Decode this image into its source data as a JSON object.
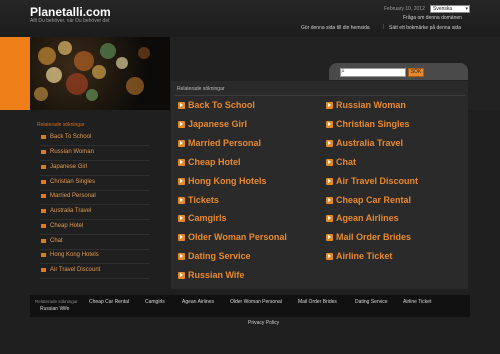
{
  "header": {
    "site_name": "Planetalli.com",
    "tagline": "Allt Du behöver, när Du behöver det",
    "date": "February 10, 2012",
    "language": "Svenska",
    "ask_link": "Fråga om denna domänen",
    "homepage_link": "Gör denna sida till din hemsida",
    "separator": "|",
    "bookmark_link": "Sätt ett bokmärke på denna sida"
  },
  "search": {
    "button_label": "SÖK",
    "value": ""
  },
  "sidebar": {
    "title": "Relaterade sökningar",
    "items": [
      {
        "label": "Back To School"
      },
      {
        "label": "Russian Woman"
      },
      {
        "label": "Japanese Girl"
      },
      {
        "label": "Christian Singles"
      },
      {
        "label": "Married Personal"
      },
      {
        "label": "Australia Travel"
      },
      {
        "label": "Cheap Hotel"
      },
      {
        "label": "Chat"
      },
      {
        "label": "Hong Kong Hotels"
      },
      {
        "label": "Air Travel Discount"
      }
    ]
  },
  "main": {
    "title": "Relaterade sökningar",
    "left_links": [
      {
        "label": "Back To School"
      },
      {
        "label": "Japanese Girl"
      },
      {
        "label": "Married Personal"
      },
      {
        "label": "Cheap Hotel"
      },
      {
        "label": "Hong Kong Hotels"
      },
      {
        "label": "Tickets"
      },
      {
        "label": "Camgirls"
      },
      {
        "label": "Older Woman Personal"
      },
      {
        "label": "Dating Service"
      },
      {
        "label": "Russian Wife"
      }
    ],
    "right_links": [
      {
        "label": "Russian Woman"
      },
      {
        "label": "Christian Singles"
      },
      {
        "label": "Australia Travel"
      },
      {
        "label": "Chat"
      },
      {
        "label": "Air Travel Discount"
      },
      {
        "label": "Cheap Car Rental"
      },
      {
        "label": "Agean Airlines"
      },
      {
        "label": "Mail Order Brides"
      },
      {
        "label": "Airline Ticket"
      }
    ]
  },
  "bottom_bar": {
    "title": "Relaterade sökningar",
    "links": [
      {
        "label": "Cheap Car Rental"
      },
      {
        "label": "Camgirls"
      },
      {
        "label": "Agean Airlines"
      },
      {
        "label": "Older Woman Personal"
      },
      {
        "label": "Mail Order Brides"
      },
      {
        "label": "Dating Service"
      },
      {
        "label": "Airline Ticket"
      },
      {
        "label": "Russian Wife"
      }
    ]
  },
  "footer": {
    "privacy": "Privacy Policy"
  },
  "colors": {
    "accent": "#ee7f19",
    "link": "#e8892d",
    "background": "#1f1f1f"
  },
  "icons": {
    "link_bullet": "orange-arrow-icon",
    "search": "magnifier-icon"
  }
}
